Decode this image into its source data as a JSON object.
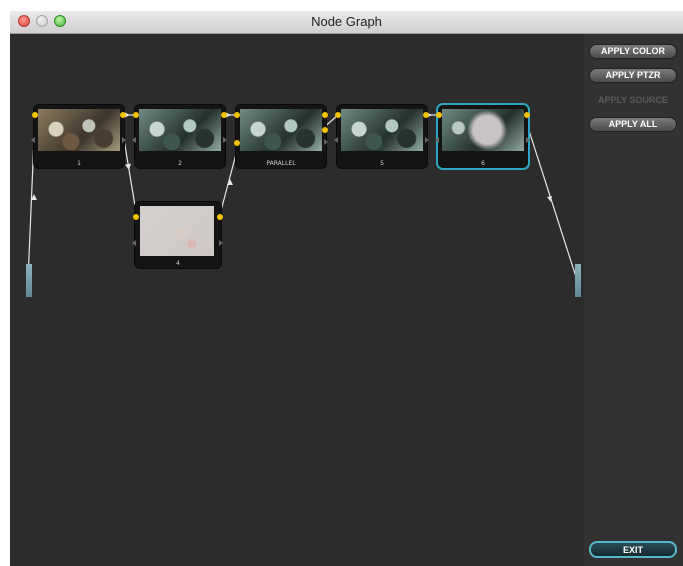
{
  "window": {
    "title": "Node Graph"
  },
  "nodes": [
    {
      "id": "n1",
      "label": "1",
      "thumbnail": "warm-film-frame"
    },
    {
      "id": "n2",
      "label": "2",
      "thumbnail": "teal-film-frame"
    },
    {
      "id": "n3",
      "label": "PARALLEL",
      "thumbnail": "teal-film-frame"
    },
    {
      "id": "n5",
      "label": "5",
      "thumbnail": "teal-film-frame"
    },
    {
      "id": "n6",
      "label": "6",
      "thumbnail": "blurred-teal-frame",
      "selected": true
    },
    {
      "id": "n4",
      "label": "4",
      "thumbnail": "washed-out-frame"
    }
  ],
  "sidebar": {
    "buttons": [
      {
        "label": "APPLY COLOR",
        "enabled": true
      },
      {
        "label": "APPLY PTZR",
        "enabled": true
      },
      {
        "label": "APPLY SOURCE",
        "enabled": false
      },
      {
        "label": "APPLY ALL",
        "enabled": true
      }
    ],
    "exit_label": "EXIT"
  },
  "colors": {
    "canvas": "#2c2c2c",
    "selection": "#2fa6c0",
    "port": "#f2c200",
    "connection": "#e6e6e6"
  }
}
